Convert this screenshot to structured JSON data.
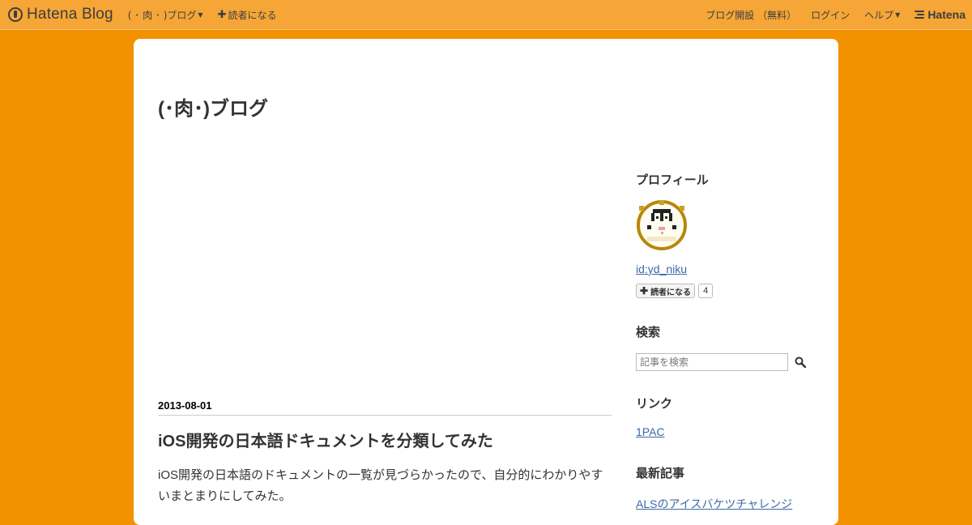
{
  "topbar": {
    "logo_text": "Hatena Blog",
    "blog_menu": "( ･ 肉 ･ )ブログ",
    "subscribe": "読者になる",
    "start_blog": "ブログ開設 （無料）",
    "login": "ログイン",
    "help": "ヘルプ",
    "hatena": "Hatena"
  },
  "blog": {
    "title": "(･肉･)ブログ"
  },
  "entry": {
    "date": "2013-08-01",
    "title": "iOS開発の日本語ドキュメントを分類してみた",
    "body": "iOS開発の日本語のドキュメントの一覧が見づらかったので、自分的にわかりやすいまとまりにしてみた。"
  },
  "sidebar": {
    "profile": {
      "title": "プロフィール",
      "id": "id:yd_niku",
      "subscribe_label": "読者になる",
      "subscriber_count": "4"
    },
    "search": {
      "title": "検索",
      "placeholder": "記事を検索"
    },
    "links": {
      "title": "リンク",
      "items": [
        "1PAC"
      ]
    },
    "recent": {
      "title": "最新記事",
      "items": [
        "ALSのアイスバケツチャレンジ"
      ]
    }
  },
  "colors": {
    "background": "#f39200",
    "topbar": "#f5a637",
    "link": "#3b6aa7"
  }
}
